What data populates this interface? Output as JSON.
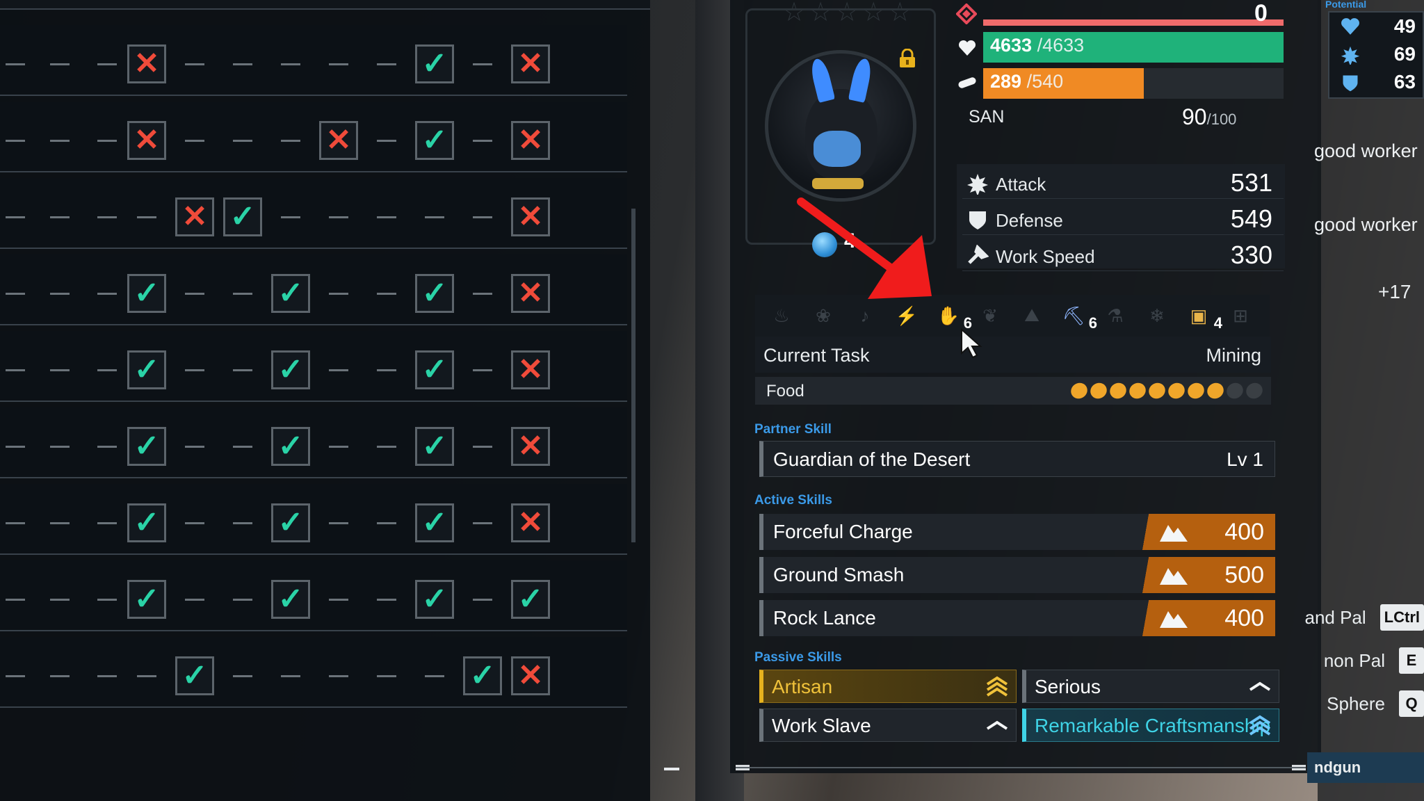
{
  "grid": {
    "rows": [
      [
        "dash",
        "dash",
        "dash",
        "no",
        "dash",
        "dash",
        "dash",
        "dash",
        "dash",
        "yes",
        "dash",
        "no"
      ],
      [
        "dash",
        "dash",
        "dash",
        "no",
        "dash",
        "dash",
        "dash",
        "no",
        "dash",
        "yes",
        "dash",
        "no"
      ],
      [
        "dash",
        "dash",
        "dash",
        "dash",
        "no",
        "yes",
        "dash",
        "dash",
        "dash",
        "dash",
        "dash",
        "no"
      ],
      [
        "dash",
        "dash",
        "dash",
        "yes",
        "dash",
        "dash",
        "yes",
        "dash",
        "dash",
        "yes",
        "dash",
        "no"
      ],
      [
        "dash",
        "dash",
        "dash",
        "yes",
        "dash",
        "dash",
        "yes",
        "dash",
        "dash",
        "yes",
        "dash",
        "no"
      ],
      [
        "dash",
        "dash",
        "dash",
        "yes",
        "dash",
        "dash",
        "yes",
        "dash",
        "dash",
        "yes",
        "dash",
        "no"
      ],
      [
        "dash",
        "dash",
        "dash",
        "yes",
        "dash",
        "dash",
        "yes",
        "dash",
        "dash",
        "yes",
        "dash",
        "no"
      ],
      [
        "dash",
        "dash",
        "dash",
        "yes",
        "dash",
        "dash",
        "yes",
        "dash",
        "dash",
        "yes",
        "dash",
        "yes"
      ],
      [
        "dash",
        "dash",
        "dash",
        "dash",
        "yes",
        "dash",
        "dash",
        "dash",
        "dash",
        "dash",
        "yes",
        "no"
      ]
    ]
  },
  "pal": {
    "exp_value": "0",
    "hp": {
      "current": "4633",
      "max": " /4633",
      "fraction": 1.0
    },
    "stamina": {
      "current": "289",
      "max": " /540",
      "fraction": 0.535
    },
    "san": {
      "label": "SAN",
      "current": "90",
      "max": "/100"
    },
    "stats": [
      {
        "icon": "attack-icon",
        "label": "Attack",
        "value": "531"
      },
      {
        "icon": "defense-icon",
        "label": "Defense",
        "value": "549"
      },
      {
        "icon": "work-speed-icon",
        "label": "Work Speed",
        "value": "330"
      }
    ],
    "sphere_level": "4",
    "work_icons": [
      {
        "icon": "kindling-icon",
        "level": ""
      },
      {
        "icon": "watering-icon",
        "level": ""
      },
      {
        "icon": "planting-icon",
        "level": ""
      },
      {
        "icon": "generating-electricity-icon",
        "level": ""
      },
      {
        "icon": "handiwork-icon",
        "level": "6"
      },
      {
        "icon": "gathering-icon",
        "level": ""
      },
      {
        "icon": "lumbering-icon",
        "level": ""
      },
      {
        "icon": "mining-icon",
        "level": "6"
      },
      {
        "icon": "medicine-production-icon",
        "level": ""
      },
      {
        "icon": "cooling-icon",
        "level": ""
      },
      {
        "icon": "transporting-icon",
        "level": "4"
      },
      {
        "icon": "farming-icon",
        "level": ""
      }
    ],
    "current_task_label": "Current Task",
    "current_task_value": "Mining",
    "food_label": "Food",
    "food": {
      "filled": 8,
      "total": 10
    },
    "partner_skill_heading": "Partner Skill",
    "partner_skill": {
      "name": "Guardian of the Desert",
      "level": "Lv 1"
    },
    "active_skills_heading": "Active Skills",
    "active_skills": [
      {
        "name": "Forceful Charge",
        "element": "ground-element-icon",
        "power": "400"
      },
      {
        "name": "Ground Smash",
        "element": "ground-element-icon",
        "power": "500"
      },
      {
        "name": "Rock Lance",
        "element": "ground-element-icon",
        "power": "400"
      }
    ],
    "passive_skills_heading": "Passive Skills",
    "passive_skills": [
      {
        "name": "Artisan",
        "tier": "gold"
      },
      {
        "name": "Serious",
        "tier": "normal"
      },
      {
        "name": "Work Slave",
        "tier": "normal"
      },
      {
        "name": "Remarkable Craftsmanship",
        "tier": "rainbow"
      }
    ]
  },
  "right": {
    "potential_label": "Potential",
    "potential": [
      {
        "icon": "hp-potential-icon",
        "value": "49"
      },
      {
        "icon": "attack-potential-icon",
        "value": "69"
      },
      {
        "icon": "defense-potential-icon",
        "value": "63"
      }
    ],
    "good_worker_1": "good worker",
    "good_worker_2": "good worker",
    "plus_value": "+17",
    "commands": [
      {
        "text": "and Pal",
        "key": "LCtrl"
      },
      {
        "text": "non Pal",
        "key": "E"
      },
      {
        "text": "Sphere",
        "key": "Q"
      }
    ],
    "bottom_tab": "ndgun"
  },
  "colors": {
    "hp": "#1fb27a",
    "stamina": "#f08a24",
    "exp": "#f06b6b",
    "check": "#2ad3a7",
    "cross": "#f04b3a",
    "accent_blue": "#3b9ae8",
    "skill_cost": "#b5600f",
    "artisan_gold": "#e6b21e",
    "rainbow_cyan": "#3fd3e6"
  }
}
